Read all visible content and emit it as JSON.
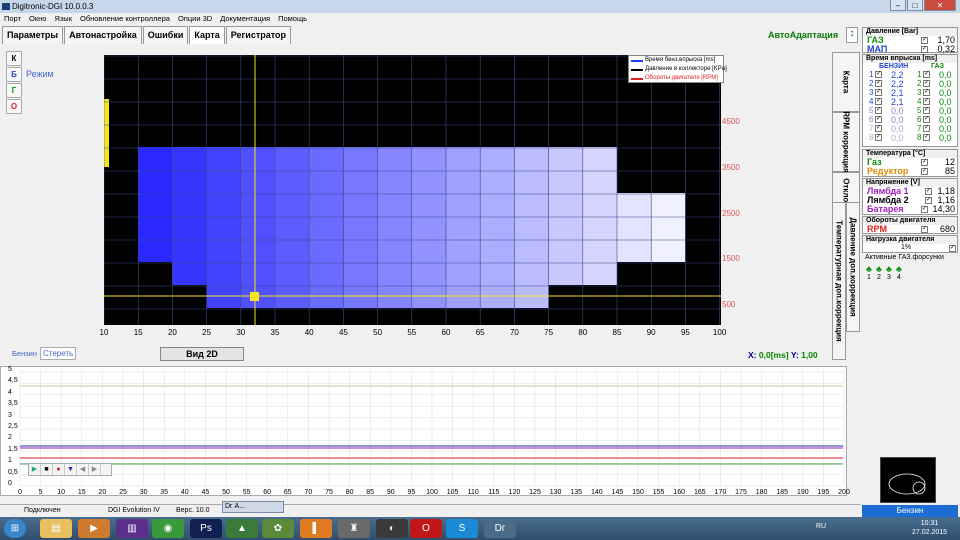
{
  "window": {
    "title": "Digitronic-DGI  10.0.0.3",
    "btn_min": "–",
    "btn_max": "□",
    "btn_close": "✕"
  },
  "menu": [
    "Порт",
    "Окно",
    "Язык",
    "Обновление контроллера",
    "Опции 3D",
    "Документация",
    "Помощь"
  ],
  "tabs": [
    "Параметры",
    "Автонастройка",
    "Ошибки",
    "Карта",
    "Регистратор"
  ],
  "autoadapt": "АвтоАдаптация",
  "side_buttons": [
    "К",
    "Б",
    "Г",
    "О"
  ],
  "mode_label": "Режим",
  "legend": [
    {
      "label": "Время бенз.впрыска [ms]",
      "color": "#1f3cff"
    },
    {
      "label": "Давление в коллекторе [KPa]",
      "color": "#000000"
    },
    {
      "label": "Обороты двигателя [RPM]",
      "color": "#e02020"
    }
  ],
  "map": {
    "x_ticks": [
      "10",
      "15",
      "20",
      "25",
      "30",
      "35",
      "40",
      "45",
      "50",
      "55",
      "60",
      "65",
      "70",
      "75",
      "80",
      "85",
      "90",
      "95",
      "100"
    ],
    "y_ticks": [
      "4500",
      "3500",
      "2500",
      "1500",
      "500"
    ],
    "cursor_x": 32,
    "cursor_y": 500
  },
  "vertical_tabs": [
    "Карта",
    "RPM коррекция",
    "Отклонение",
    "Температурная доп.коррекция",
    "Давление доп.коррекция"
  ],
  "bottom": {
    "benzin": "Бензин",
    "clear": "Стереть",
    "view2d": "Вид 2D",
    "x_label": "X:",
    "x_value": "0,0[ms]",
    "y_label": "Y:",
    "y_value": "1,00"
  },
  "pressure": {
    "header": "Давление [Bar]",
    "gas_label": "ГАЗ",
    "gas_value": "1,70",
    "map_label": "МАП",
    "map_value": "0,32"
  },
  "injection": {
    "header": "Время впрыска [ms]",
    "col_benz": "БЕНЗИН",
    "col_gas": "ГАЗ",
    "rows": [
      {
        "n": "1",
        "b": "2,2",
        "g": "0,0"
      },
      {
        "n": "2",
        "b": "2,2",
        "g": "0,0"
      },
      {
        "n": "3",
        "b": "2,1",
        "g": "0,0"
      },
      {
        "n": "4",
        "b": "2,1",
        "g": "0,0"
      },
      {
        "n": "5",
        "b": "0,0",
        "g": "0,0"
      },
      {
        "n": "6",
        "b": "0,0",
        "g": "0,0"
      },
      {
        "n": "7",
        "b": "0,0",
        "g": "0,0"
      },
      {
        "n": "8",
        "b": "0,0",
        "g": "0,0"
      }
    ]
  },
  "temperature": {
    "header": "Температура [°C]",
    "gas_label": "Газ",
    "gas_value": "12",
    "red_label": "Редуктор",
    "red_value": "85"
  },
  "voltage": {
    "header": "Напряжение [V]",
    "l1_label": "Лямбда 1",
    "l1_value": "1,18",
    "l2_label": "Лямбда 2",
    "l2_value": "1,16",
    "bat_label": "Батарея",
    "bat_value": "14,30"
  },
  "rpm": {
    "header": "Обороты двигателя",
    "label": "RPM",
    "value": "680"
  },
  "load": {
    "header": "Нагрузка двигателя",
    "value": "1%"
  },
  "injectors": {
    "header": "Активные ГАЗ.форсунки",
    "nums": [
      "1",
      "2",
      "3",
      "4"
    ]
  },
  "graph": {
    "y_ticks": [
      "5",
      "4,5",
      "4",
      "3,5",
      "3",
      "2,5",
      "2",
      "1,5",
      "1",
      "0,5",
      "0"
    ],
    "x_ticks": [
      "0",
      "5",
      "10",
      "15",
      "20",
      "25",
      "30",
      "35",
      "40",
      "45",
      "50",
      "55",
      "60",
      "65",
      "70",
      "75",
      "80",
      "85",
      "90",
      "95",
      "100",
      "105",
      "110",
      "115",
      "120",
      "125",
      "130",
      "135",
      "140",
      "145",
      "150",
      "155",
      "160",
      "165",
      "170",
      "175",
      "180",
      "185",
      "190",
      "195",
      "200"
    ]
  },
  "status": {
    "connected": "Подключен",
    "device": "DGI Evolution IV",
    "version": "Верс. 10.0",
    "fuel": "Бензин"
  },
  "popup": "Dг A...",
  "taskbar": {
    "lang": "RU",
    "time": "10:31",
    "date": "27.02.2015"
  }
}
